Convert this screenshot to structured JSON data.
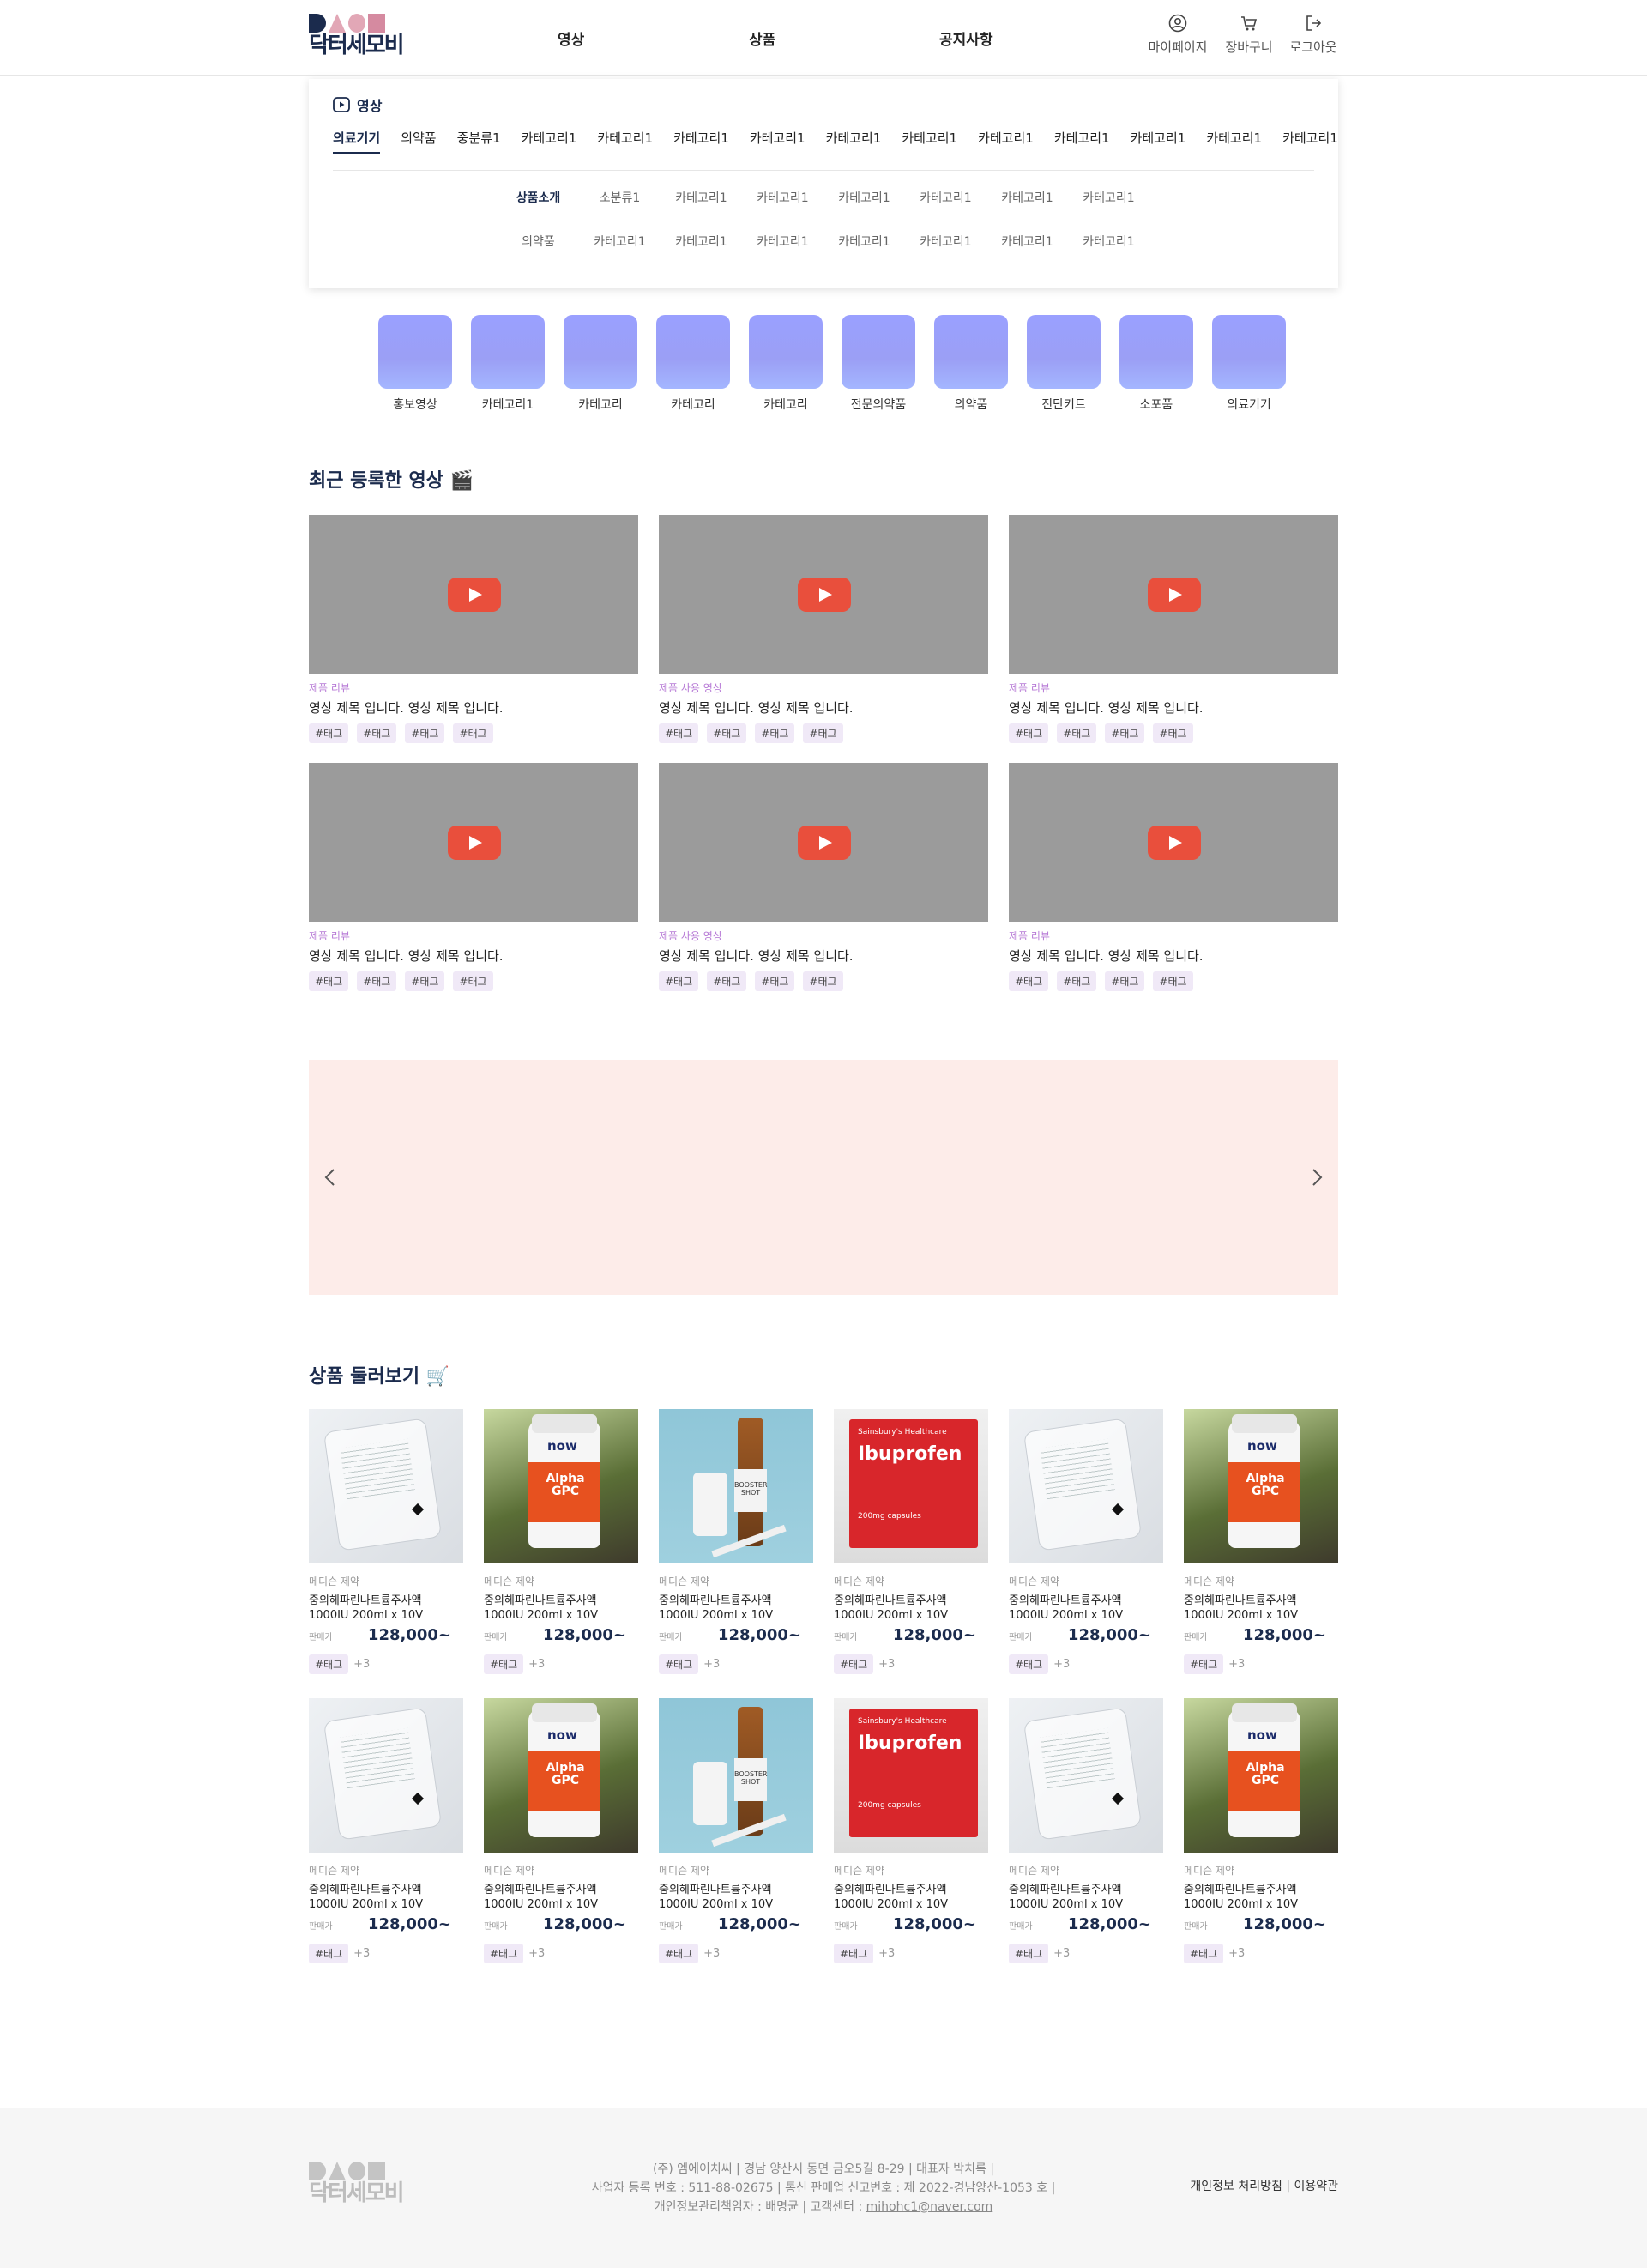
{
  "header": {
    "logo_text": "닥터세모비",
    "nav": [
      "영상",
      "상품",
      "공지사항"
    ],
    "util": [
      "마이페이지",
      "장바구니",
      "로그아웃"
    ]
  },
  "category_panel": {
    "title": "영상",
    "main_categories": [
      "의료기기",
      "의약품",
      "중분류1",
      "카테고리1",
      "카테고리1",
      "카테고리1",
      "카테고리1",
      "카테고리1",
      "카테고리1",
      "카테고리1",
      "카테고리1",
      "카테고리1",
      "카테고리1",
      "카테고리1"
    ],
    "sub_row1": [
      "상품소개",
      "소분류1",
      "카테고리1",
      "카테고리1",
      "카테고리1",
      "카테고리1",
      "카테고리1",
      "카테고리1"
    ],
    "sub_row2": [
      "의약품",
      "카테고리1",
      "카테고리1",
      "카테고리1",
      "카테고리1",
      "카테고리1",
      "카테고리1",
      "카테고리1"
    ]
  },
  "quick_menu": [
    "홍보영상",
    "카테고리1",
    "카테고리",
    "카테고리",
    "카테고리",
    "전문의약품",
    "의약품",
    "진단키트",
    "소포품",
    "의료기기"
  ],
  "recent_videos": {
    "title": "최근 등록한 영상 🎬",
    "items": [
      {
        "category": "제품 리뷰",
        "title": "영상 제목 입니다. 영상 제목 입니다.",
        "tags": [
          "#태그",
          "#태그",
          "#태그",
          "#태그"
        ]
      },
      {
        "category": "제품 사용 영상",
        "title": "영상 제목 입니다. 영상 제목 입니다.",
        "tags": [
          "#태그",
          "#태그",
          "#태그",
          "#태그"
        ]
      },
      {
        "category": "제품 리뷰",
        "title": "영상 제목 입니다. 영상 제목 입니다.",
        "tags": [
          "#태그",
          "#태그",
          "#태그",
          "#태그"
        ]
      },
      {
        "category": "제품 리뷰",
        "title": "영상 제목 입니다. 영상 제목 입니다.",
        "tags": [
          "#태그",
          "#태그",
          "#태그",
          "#태그"
        ]
      },
      {
        "category": "제품 사용 영상",
        "title": "영상 제목 입니다. 영상 제목 입니다.",
        "tags": [
          "#태그",
          "#태그",
          "#태그",
          "#태그"
        ]
      },
      {
        "category": "제품 리뷰",
        "title": "영상 제목 입니다. 영상 제목 입니다.",
        "tags": [
          "#태그",
          "#태그",
          "#태그",
          "#태그"
        ]
      }
    ]
  },
  "products": {
    "title": "상품 둘러보기 🛒",
    "items": [
      {
        "image": "iv-bag",
        "maker": "메디슨 제약",
        "name": "중외헤파린나트륨주사액 1000IU 200ml x 10V",
        "price_label": "판매가",
        "price": "128,000~",
        "tag": "#태그",
        "more": "+3"
      },
      {
        "image": "vitamin-bottle",
        "maker": "메디슨 제약",
        "name": "중외헤파린나트륨주사액 1000IU 200ml x 10V",
        "price_label": "판매가",
        "price": "128,000~",
        "tag": "#태그",
        "more": "+3"
      },
      {
        "image": "vial",
        "maker": "메디슨 제약",
        "name": "중외헤파린나트륨주사액 1000IU 200ml x 10V",
        "price_label": "판매가",
        "price": "128,000~",
        "tag": "#태그",
        "more": "+3"
      },
      {
        "image": "ibuprofen-box",
        "maker": "메디슨 제약",
        "name": "중외헤파린나트륨주사액 1000IU 200ml x 10V",
        "price_label": "판매가",
        "price": "128,000~",
        "tag": "#태그",
        "more": "+3"
      },
      {
        "image": "iv-bag",
        "maker": "메디슨 제약",
        "name": "중외헤파린나트륨주사액 1000IU 200ml x 10V",
        "price_label": "판매가",
        "price": "128,000~",
        "tag": "#태그",
        "more": "+3"
      },
      {
        "image": "vitamin-bottle",
        "maker": "메디슨 제약",
        "name": "중외헤파린나트륨주사액 1000IU 200ml x 10V",
        "price_label": "판매가",
        "price": "128,000~",
        "tag": "#태그",
        "more": "+3"
      },
      {
        "image": "iv-bag",
        "maker": "메디슨 제약",
        "name": "중외헤파린나트륨주사액 1000IU 200ml x 10V",
        "price_label": "판매가",
        "price": "128,000~",
        "tag": "#태그",
        "more": "+3"
      },
      {
        "image": "vitamin-bottle",
        "maker": "메디슨 제약",
        "name": "중외헤파린나트륨주사액 1000IU 200ml x 10V",
        "price_label": "판매가",
        "price": "128,000~",
        "tag": "#태그",
        "more": "+3"
      },
      {
        "image": "vial",
        "maker": "메디슨 제약",
        "name": "중외헤파린나트륨주사액 1000IU 200ml x 10V",
        "price_label": "판매가",
        "price": "128,000~",
        "tag": "#태그",
        "more": "+3"
      },
      {
        "image": "ibuprofen-box",
        "maker": "메디슨 제약",
        "name": "중외헤파린나트륨주사액 1000IU 200ml x 10V",
        "price_label": "판매가",
        "price": "128,000~",
        "tag": "#태그",
        "more": "+3"
      },
      {
        "image": "iv-bag",
        "maker": "메디슨 제약",
        "name": "중외헤파린나트륨주사액 1000IU 200ml x 10V",
        "price_label": "판매가",
        "price": "128,000~",
        "tag": "#태그",
        "more": "+3"
      },
      {
        "image": "vitamin-bottle",
        "maker": "메디슨 제약",
        "name": "중외헤파린나트륨주사액 1000IU 200ml x 10V",
        "price_label": "판매가",
        "price": "128,000~",
        "tag": "#태그",
        "more": "+3"
      }
    ]
  },
  "product_image_text": {
    "vitamin_brand": "now",
    "vitamin_label": "Alpha GPC",
    "vial_label": "BOOSTER SHOT",
    "ibu_maker": "Sainsbury's Healthcare",
    "ibu_name": "Ibuprofen",
    "ibu_dose": "200mg capsules"
  },
  "footer": {
    "logo_text": "닥터세모비",
    "line1": "(주) 엠에이치씨 | 경남 양산시 동면 금오5길 8-29 | 대표자 박치록 |",
    "line2": "사업자 등록 번호 : 511-88-02675 | 통신 판매업 신고번호 : 제 2022-경남양산-1053 호 |",
    "line3": "개인정보관리책임자 : 배명균 | 고객센터 : ",
    "email": "mihohc1@naver.com",
    "links": "개인정보 처리방침 | 이용약관"
  },
  "colors": {
    "brand_navy": "#1b2b4d",
    "accent_purple": "#b77ad6",
    "play_red": "#e94f3c",
    "banner_bg": "#fdece9",
    "quick_tile": "#9aa0ff"
  }
}
